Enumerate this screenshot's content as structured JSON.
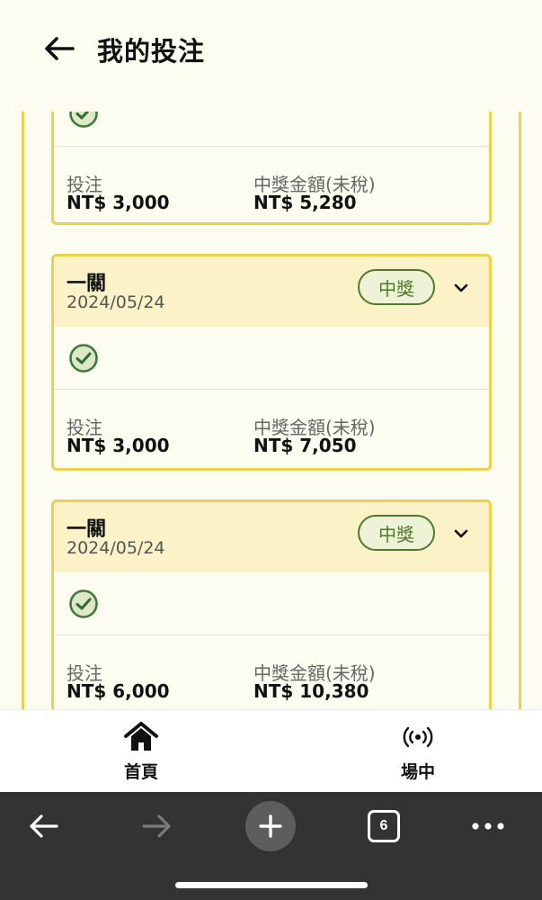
{
  "header": {
    "title": "我的投注",
    "back_icon": "arrow-left-icon"
  },
  "cards": [
    {
      "name": "",
      "date": "",
      "badge": "",
      "bet_label": "投注",
      "bet_value": "NT$ 3,000",
      "win_label": "中獎金額(未稅)",
      "win_value": "NT$ 5,280"
    },
    {
      "name": "一關",
      "date": "2024/05/24",
      "badge": "中獎",
      "bet_label": "投注",
      "bet_value": "NT$ 3,000",
      "win_label": "中獎金額(未稅)",
      "win_value": "NT$ 7,050"
    },
    {
      "name": "一關",
      "date": "2024/05/24",
      "badge": "中獎",
      "bet_label": "投注",
      "bet_value": "NT$ 6,000",
      "win_label": "中獎金額(未稅)",
      "win_value": "NT$ 10,380"
    }
  ],
  "tabbar": {
    "items": [
      {
        "label": "首頁",
        "icon": "home-icon"
      },
      {
        "label": "場中",
        "icon": "live-broadcast-icon"
      }
    ]
  },
  "browser": {
    "tab_count": "6"
  },
  "colors": {
    "accent_yellow": "#f0cf4c",
    "card_header_bg": "#fcf2c7",
    "win_green": "#4f7a2c",
    "page_bg": "#fdfcf0"
  }
}
